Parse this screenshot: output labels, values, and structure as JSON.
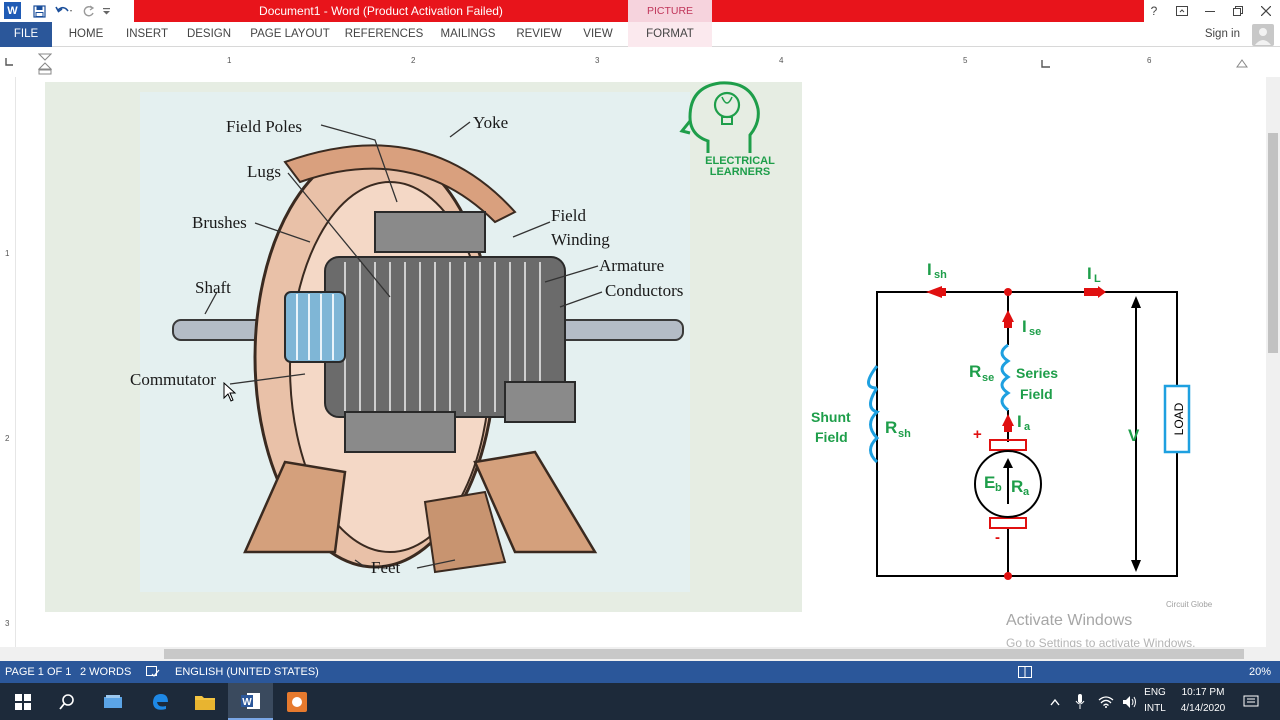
{
  "window": {
    "title": "Document1 -  Word (Product Activation Failed)",
    "context_tab_group": "PICTURE TOOLS"
  },
  "ribbon": {
    "tabs": [
      {
        "label": "FILE"
      },
      {
        "label": "HOME"
      },
      {
        "label": "INSERT"
      },
      {
        "label": "DESIGN"
      },
      {
        "label": "PAGE LAYOUT"
      },
      {
        "label": "REFERENCES"
      },
      {
        "label": "MAILINGS"
      },
      {
        "label": "REVIEW"
      },
      {
        "label": "VIEW"
      },
      {
        "label": "FORMAT"
      }
    ],
    "signin": "Sign in"
  },
  "ruler": {
    "numbers": [
      "1",
      "2",
      "3",
      "4",
      "5",
      "6"
    ],
    "left_numbers": [
      "1",
      "2",
      "3"
    ]
  },
  "motor_figure": {
    "labels": {
      "field_poles": "Field Poles",
      "yoke": "Yoke",
      "lugs": "Lugs",
      "brushes": "Brushes",
      "field": "Field",
      "winding": "Winding",
      "armature": "Armature",
      "conductors": "Conductors",
      "shaft": "Shaft",
      "commutator": "Commutator",
      "feet": "Feet"
    }
  },
  "logo": {
    "line1": "ELECTRICAL",
    "line2": "LEARNERS"
  },
  "circuit": {
    "i_sh": "I",
    "i_sh_sub": "sh",
    "i_l": "I",
    "i_l_sub": "L",
    "i_se": "I",
    "i_se_sub": "se",
    "r_se": "R",
    "r_se_sub": "se",
    "series": "Series",
    "series_field": "Field",
    "i_a": "I",
    "i_a_sub": "a",
    "shunt": "Shunt",
    "shunt_field": "Field",
    "r_sh": "R",
    "r_sh_sub": "sh",
    "plus": "+",
    "minus": "-",
    "e_b": "E",
    "e_b_sub": "b",
    "r_a": "R",
    "r_a_sub": "a",
    "v": "V",
    "load": "LOAD"
  },
  "credit": "Circuit Globe",
  "activation": {
    "title": "Activate Windows",
    "subtitle": "Go to Settings to activate Windows."
  },
  "statusbar": {
    "page": "PAGE 1 OF 1",
    "words": "2 WORDS",
    "language": "ENGLISH (UNITED STATES)",
    "zoom": "20%"
  },
  "taskbar": {
    "lang": "ENG",
    "layout": "INTL",
    "time": "10:17 PM",
    "date": "4/14/2020"
  },
  "colors": {
    "accent": "#2b579a",
    "title_red": "#e8141b",
    "circuit_green": "#1e9e4a",
    "circuit_red": "#e01010",
    "circuit_blue": "#1ea0e0"
  }
}
